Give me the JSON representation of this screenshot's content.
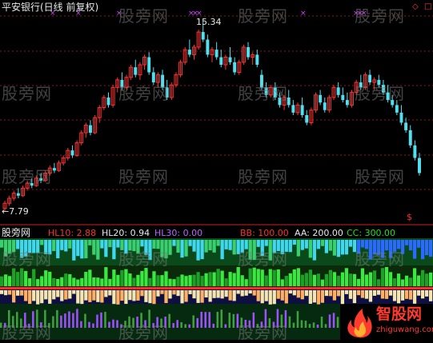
{
  "chart_title": "平安银行(日线 前复权)",
  "price_high_label": "15.34",
  "price_low_label": "←7.79",
  "signal_mark": "$",
  "sub_panel_name": "股旁网",
  "indicators": [
    {
      "label": "HL10: 2.88",
      "color": "#ff3030"
    },
    {
      "label": "HL20: 0.94",
      "color": "#e8e8e8"
    },
    {
      "label": "HL30: 0.00",
      "color": "#c060ff"
    },
    {
      "label": "BB: 100.00",
      "color": "#ff3030"
    },
    {
      "label": "AA: 200.00",
      "color": "#e8e8e8"
    },
    {
      "label": "CC: 300.00",
      "color": "#20e020"
    }
  ],
  "watermark_text": "股旁网",
  "logo": {
    "brand": "智股网",
    "url": "zhiguwang.com"
  },
  "window_controls": [
    "◇",
    "□"
  ],
  "colors": {
    "up": "#ff3333",
    "down": "#50e0f0",
    "grid": "#8a1a1a",
    "separator": "#d02020",
    "purple_marker": "#cc44ff"
  },
  "chart_data": {
    "type": "candlestick",
    "title": "平安银行(日线 前复权)",
    "price_range": [
      7.79,
      15.34
    ],
    "annotations": [
      "15.34",
      "←7.79"
    ],
    "indicator_values": {
      "HL10": 2.88,
      "HL20": 0.94,
      "HL30": 0.0,
      "BB": 100.0,
      "AA": 200.0,
      "CC": 300.0
    },
    "candles": [
      [
        7.9,
        8.2,
        7.79,
        8.1
      ],
      [
        8.1,
        8.4,
        8.0,
        8.3
      ],
      [
        8.3,
        8.6,
        8.2,
        8.5
      ],
      [
        8.5,
        8.7,
        8.3,
        8.4
      ],
      [
        8.4,
        8.8,
        8.35,
        8.7
      ],
      [
        8.7,
        9.0,
        8.6,
        8.9
      ],
      [
        8.9,
        9.1,
        8.7,
        8.8
      ],
      [
        8.8,
        9.2,
        8.75,
        9.1
      ],
      [
        9.1,
        9.3,
        8.9,
        9.0
      ],
      [
        9.0,
        9.4,
        8.95,
        9.3
      ],
      [
        9.3,
        9.6,
        9.2,
        9.5
      ],
      [
        9.5,
        9.7,
        9.3,
        9.4
      ],
      [
        9.4,
        9.8,
        9.35,
        9.7
      ],
      [
        9.7,
        10.0,
        9.6,
        9.9
      ],
      [
        9.9,
        10.3,
        9.8,
        10.2
      ],
      [
        10.2,
        10.4,
        9.9,
        10.0
      ],
      [
        10.0,
        10.6,
        9.95,
        10.5
      ],
      [
        10.5,
        11.0,
        10.4,
        10.9
      ],
      [
        10.9,
        11.3,
        10.7,
        11.2
      ],
      [
        11.2,
        11.4,
        10.8,
        10.9
      ],
      [
        10.9,
        11.6,
        10.85,
        11.5
      ],
      [
        11.5,
        12.0,
        11.3,
        11.9
      ],
      [
        11.9,
        12.4,
        11.8,
        12.3
      ],
      [
        12.3,
        12.5,
        11.9,
        12.0
      ],
      [
        12.0,
        12.8,
        11.9,
        12.7
      ],
      [
        12.7,
        13.1,
        12.5,
        13.0
      ],
      [
        13.0,
        13.3,
        12.6,
        12.7
      ],
      [
        12.7,
        13.2,
        12.6,
        13.1
      ],
      [
        13.1,
        13.6,
        13.0,
        13.5
      ],
      [
        13.5,
        13.8,
        13.1,
        13.2
      ],
      [
        13.2,
        13.7,
        13.0,
        13.6
      ],
      [
        13.6,
        14.0,
        13.4,
        13.9
      ],
      [
        13.9,
        14.1,
        13.2,
        13.3
      ],
      [
        13.3,
        13.5,
        12.8,
        12.9
      ],
      [
        12.9,
        13.3,
        12.7,
        13.2
      ],
      [
        13.2,
        13.4,
        12.6,
        12.7
      ],
      [
        12.7,
        13.0,
        12.2,
        12.3
      ],
      [
        12.3,
        12.9,
        12.2,
        12.8
      ],
      [
        12.8,
        13.3,
        12.7,
        13.2
      ],
      [
        13.2,
        13.8,
        13.1,
        13.7
      ],
      [
        13.7,
        14.3,
        13.6,
        14.2
      ],
      [
        14.2,
        14.6,
        13.9,
        14.0
      ],
      [
        14.0,
        14.4,
        13.8,
        14.3
      ],
      [
        14.3,
        15.0,
        14.2,
        14.9
      ],
      [
        14.9,
        15.34,
        14.5,
        14.6
      ],
      [
        14.6,
        14.8,
        13.9,
        14.0
      ],
      [
        14.0,
        14.3,
        13.7,
        14.2
      ],
      [
        14.2,
        14.5,
        13.8,
        13.9
      ],
      [
        13.9,
        14.2,
        13.5,
        13.6
      ],
      [
        13.6,
        14.0,
        13.4,
        13.9
      ],
      [
        13.9,
        14.3,
        13.6,
        13.7
      ],
      [
        13.7,
        13.9,
        13.2,
        13.3
      ],
      [
        13.3,
        13.8,
        13.2,
        13.7
      ],
      [
        13.7,
        14.4,
        13.6,
        14.3
      ],
      [
        14.3,
        14.5,
        13.8,
        13.9
      ],
      [
        13.9,
        14.1,
        13.6,
        14.0
      ],
      [
        14.0,
        14.2,
        13.5,
        13.6
      ],
      [
        13.2,
        13.4,
        12.6,
        12.7
      ],
      [
        12.7,
        12.9,
        12.3,
        12.4
      ],
      [
        12.4,
        12.8,
        12.3,
        12.7
      ],
      [
        12.7,
        12.9,
        12.2,
        12.3
      ],
      [
        12.3,
        12.5,
        11.9,
        12.0
      ],
      [
        12.0,
        12.4,
        11.8,
        12.3
      ],
      [
        12.3,
        12.6,
        11.9,
        12.0
      ],
      [
        12.0,
        12.2,
        11.6,
        11.7
      ],
      [
        11.7,
        12.1,
        11.6,
        12.0
      ],
      [
        12.0,
        12.3,
        11.5,
        11.6
      ],
      [
        11.6,
        11.8,
        11.2,
        11.3
      ],
      [
        11.3,
        11.9,
        11.2,
        11.8
      ],
      [
        11.8,
        12.5,
        11.7,
        12.4
      ],
      [
        12.4,
        12.6,
        12.0,
        12.1
      ],
      [
        12.1,
        12.3,
        11.7,
        11.8
      ],
      [
        11.8,
        12.4,
        11.7,
        12.3
      ],
      [
        12.3,
        12.8,
        12.2,
        12.7
      ],
      [
        12.7,
        12.9,
        12.3,
        12.4
      ],
      [
        12.4,
        12.7,
        12.1,
        12.2
      ],
      [
        12.2,
        12.5,
        11.9,
        12.0
      ],
      [
        12.0,
        12.6,
        11.9,
        12.5
      ],
      [
        12.5,
        13.0,
        12.4,
        12.9
      ],
      [
        12.9,
        13.2,
        12.6,
        12.7
      ],
      [
        12.7,
        13.3,
        12.6,
        13.2
      ],
      [
        13.2,
        13.4,
        12.8,
        12.9
      ],
      [
        12.9,
        13.1,
        12.6,
        13.0
      ],
      [
        13.0,
        13.2,
        12.7,
        12.8
      ],
      [
        12.8,
        13.0,
        12.4,
        12.5
      ],
      [
        12.5,
        12.8,
        12.1,
        12.2
      ],
      [
        12.2,
        12.4,
        11.9,
        12.0
      ],
      [
        12.0,
        12.2,
        11.6,
        11.7
      ],
      [
        11.7,
        12.0,
        11.2,
        11.3
      ],
      [
        11.3,
        11.5,
        10.9,
        11.0
      ],
      [
        11.0,
        11.2,
        10.3,
        10.4
      ],
      [
        10.4,
        10.6,
        9.8,
        9.9
      ],
      [
        9.9,
        10.1,
        9.2,
        9.3
      ]
    ]
  }
}
